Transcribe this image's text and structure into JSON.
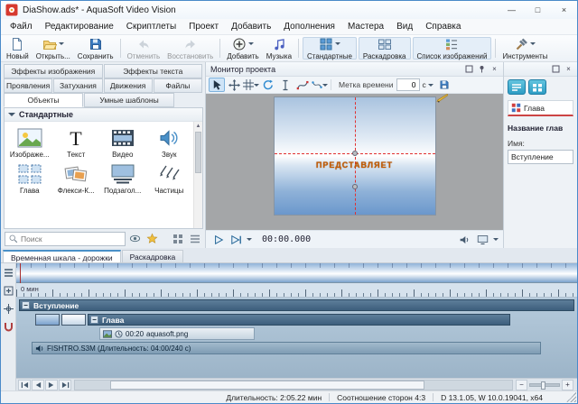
{
  "colors": {
    "accent": "#2f86c9",
    "window_border": "#4a8ac9",
    "timeline_dark": "#3c5e7c",
    "crosshair_red": "#e03030",
    "preview_text_orange": "#c55a00",
    "panel_button_cyan": "#2e9cc4"
  },
  "window": {
    "title": "DiaShow.ads* - AquaSoft Video Vision",
    "minimize": "—",
    "maximize": "□",
    "close": "×"
  },
  "menubar": {
    "items": [
      "Файл",
      "Редактирование",
      "Скриптлеты",
      "Проект",
      "Добавить",
      "Дополнения",
      "Мастера",
      "Вид",
      "Справка"
    ]
  },
  "toolbar": {
    "buttons": [
      "Новый",
      "Открыть...",
      "Сохранить",
      "Отменить",
      "Восстановить",
      "Добавить",
      "Музыка",
      "Стандартные",
      "Раскадровка",
      "Список изображений",
      "Инструменты"
    ]
  },
  "left_panel": {
    "tabs_row1": [
      "Эффекты изображения",
      "Эффекты текста"
    ],
    "tabs_row2": [
      "Проявления",
      "Затухания",
      "Движения",
      "Файлы"
    ],
    "tabs_row3": [
      "Объекты",
      "Умные шаблоны"
    ],
    "section": "Стандартные",
    "items": [
      "Изображе...",
      "Текст",
      "Видео",
      "Звук",
      "Глава",
      "Флекси-К...",
      "Подзагол...",
      "Частицы"
    ],
    "search_placeholder": "Поиск"
  },
  "monitor": {
    "title": "Монитор проекта",
    "timestamp_label": "Метка времени",
    "timestamp_value": "0",
    "timestamp_unit": "с",
    "preview_text": "ПРЕДСТАВЛЯЕТ",
    "timecode": "00:00.000"
  },
  "right_panel": {
    "tab": "Глава",
    "section_title": "Название глав",
    "name_label": "Имя:",
    "name_value": "Вступление"
  },
  "timeline": {
    "tabs": [
      "Временная шкала - дорожки",
      "Раскадровка"
    ],
    "ruler_label": "0 мин",
    "collapse_glyph": "−",
    "chapter": "Вступление",
    "group": "Глава",
    "clip": {
      "duration": "00:20",
      "name": "aquasoft.png"
    },
    "audio": "FISHTRO.S3M (Длительность: 04:00/240 с)"
  },
  "statusbar": {
    "duration": "Длительность: 2:05.22 мин",
    "aspect": "Соотношение сторон 4:3",
    "version": "D 13.1.05, W 10.0.19041, x64"
  }
}
